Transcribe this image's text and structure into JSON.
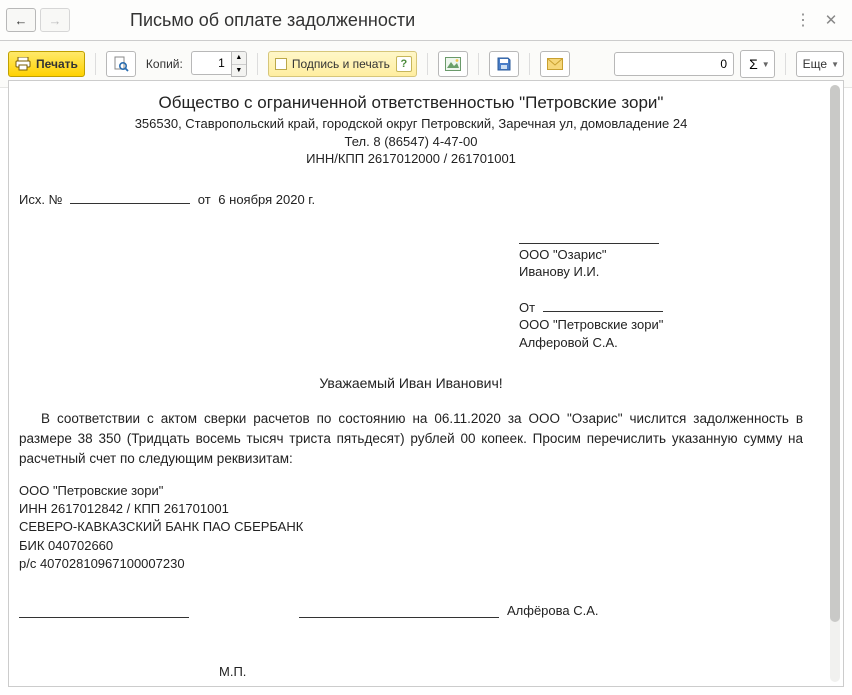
{
  "window": {
    "title": "Письмо об оплате задолженности"
  },
  "toolbar": {
    "print_label": "Печать",
    "copies_label": "Копий:",
    "copies_value": "1",
    "sign_print_label": "Подпись и печать",
    "sum_value": "0",
    "sigma_label": "Σ",
    "more_label": "Еще"
  },
  "doc": {
    "org_title": "Общество с ограниченной ответственностью \"Петровские зори\"",
    "address": "356530, Ставропольский край, городской округ Петровский, Заречная ул, домовладение 24",
    "phone": "Тел. 8 (86547) 4-47-00",
    "inn_kpp": "ИНН/КПП 2617012000 / 261701001",
    "outgoing_prefix": "Исх. №",
    "outgoing_date_prefix": "от",
    "outgoing_date": "6 ноября 2020 г.",
    "to_org": "ООО \"Озарис\"",
    "to_person": "Иванову  И.И.",
    "from_label": "От",
    "from_org": "ООО \"Петровские зори\"",
    "from_person": "Алферовой С.А.",
    "salutation": "Уважаемый Иван Иванович!",
    "body": "В соответствии с актом сверки расчетов по состоянию на 06.11.2020 за ООО \"Озарис\" числится задолженность в размере 38 350 (Тридцать восемь тысяч триста пятьдесят) рублей 00 копеек. Просим перечислить указанную сумму на расчетный счет  по следующим реквизитам:",
    "req_org": "ООО \"Петровские зори\"",
    "req_inn": "ИНН 2617012842 / КПП 261701001",
    "req_bank": "СЕВЕРО-КАВКАЗСКИЙ БАНК ПАО СБЕРБАНК",
    "req_bik": "БИК 040702660",
    "req_acc": "р/с 40702810967100007230",
    "signer": "Алфёрова С.А.",
    "stamp_label": "М.П."
  }
}
